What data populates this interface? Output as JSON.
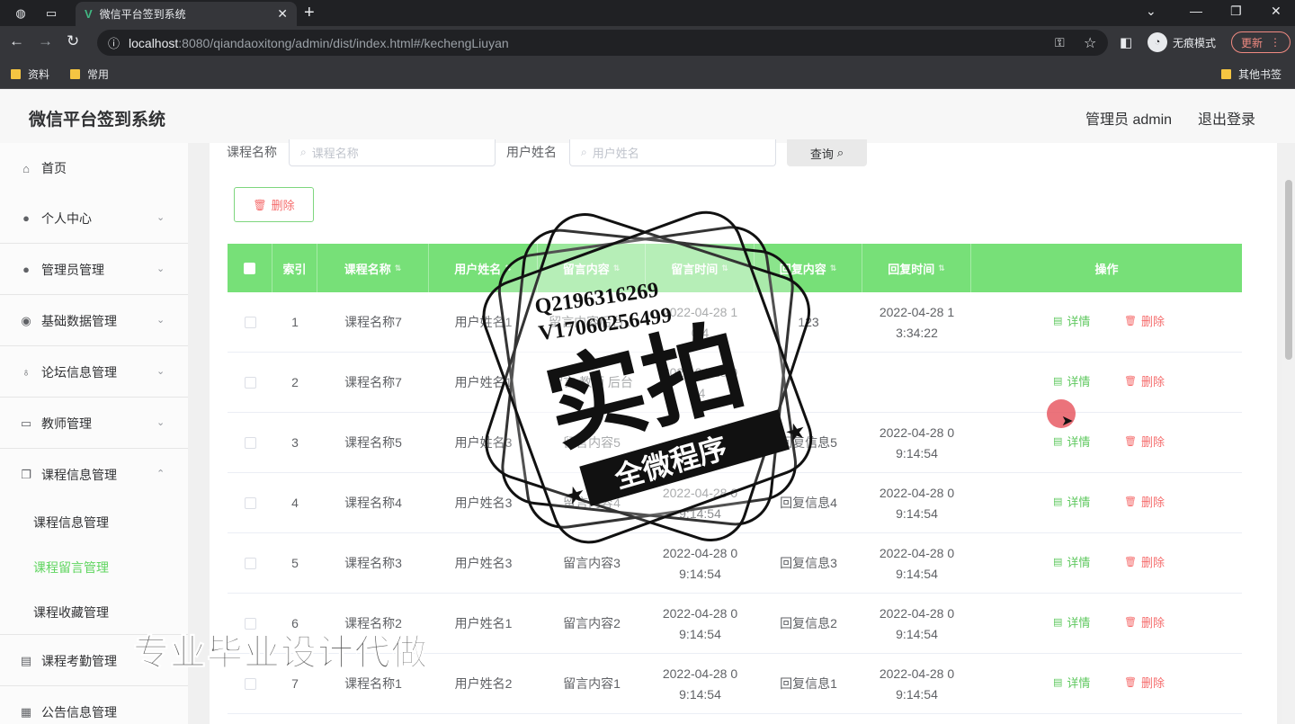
{
  "browser": {
    "tab_title": "微信平台签到系统",
    "url_host": "localhost",
    "url_rest": ":8080/qiandaoxitong/admin/dist/index.html#/kechengLiuyan",
    "incognito_label": "无痕模式",
    "update_label": "更新",
    "bookmarks": [
      "资料",
      "常用"
    ],
    "other_bookmarks": "其他书签"
  },
  "header": {
    "title": "微信平台签到系统",
    "admin": "管理员 admin",
    "logout": "退出登录"
  },
  "sidebar": {
    "items": [
      {
        "label": "首页",
        "icon": "home-icon"
      },
      {
        "label": "个人中心",
        "icon": "user-icon"
      },
      {
        "label": "管理员管理",
        "icon": "user-icon"
      },
      {
        "label": "基础数据管理",
        "icon": "location-icon"
      },
      {
        "label": "论坛信息管理",
        "icon": "microphone-icon"
      },
      {
        "label": "教师管理",
        "icon": "chat-icon"
      },
      {
        "label": "课程信息管理",
        "icon": "copy-icon"
      }
    ],
    "subitems": [
      {
        "label": "课程信息管理"
      },
      {
        "label": "课程留言管理"
      },
      {
        "label": "课程收藏管理"
      }
    ],
    "items_after": [
      {
        "label": "课程考勤管理",
        "icon": "clipboard-icon"
      },
      {
        "label": "公告信息管理",
        "icon": "grid-icon"
      }
    ]
  },
  "search": {
    "course_label": "课程名称",
    "course_placeholder": "课程名称",
    "user_label": "用户姓名",
    "user_placeholder": "用户姓名",
    "query_label": "查询"
  },
  "toolbar": {
    "delete_label": "删除"
  },
  "table": {
    "columns": [
      "索引",
      "课程名称",
      "用户姓名",
      "留言内容",
      "留言时间",
      "回复内容",
      "回复时间",
      "操作"
    ],
    "detail_label": "详情",
    "delete_label": "删除",
    "rows": [
      {
        "index": "1",
        "course": "课程名称7",
        "user": "用户姓名1",
        "message": "留言内容后台...",
        "msg_time": "2022-04-28 1 0:4",
        "reply": "123",
        "reply_time": "2022-04-28 1 3:34:22"
      },
      {
        "index": "2",
        "course": "课程名称7",
        "user": "用户姓名1",
        "message": "留言 教师 后台",
        "msg_time": "2022-04-28 0 :4",
        "reply": "",
        "reply_time": ""
      },
      {
        "index": "3",
        "course": "课程名称5",
        "user": "用户姓名3",
        "message": "留言内容5",
        "msg_time": "2022",
        "reply": "回复信息5",
        "reply_time": "2022-04-28 0 9:14:54"
      },
      {
        "index": "4",
        "course": "课程名称4",
        "user": "用户姓名3",
        "message": "留言内容4",
        "msg_time": "2022-04-28 0 9:14:54",
        "reply": "回复信息4",
        "reply_time": "2022-04-28 0 9:14:54"
      },
      {
        "index": "5",
        "course": "课程名称3",
        "user": "用户姓名3",
        "message": "留言内容3",
        "msg_time": "2022-04-28 0 9:14:54",
        "reply": "回复信息3",
        "reply_time": "2022-04-28 0 9:14:54"
      },
      {
        "index": "6",
        "course": "课程名称2",
        "user": "用户姓名1",
        "message": "留言内容2",
        "msg_time": "2022-04-28 0 9:14:54",
        "reply": "回复信息2",
        "reply_time": "2022-04-28 0 9:14:54"
      },
      {
        "index": "7",
        "course": "课程名称1",
        "user": "用户姓名2",
        "message": "留言内容1",
        "msg_time": "2022-04-28 0 9:14:54",
        "reply": "回复信息1",
        "reply_time": "2022-04-28 0 9:14:54"
      }
    ]
  },
  "watermark": {
    "line1": "Q2196316269",
    "line2": "V17060256499",
    "big": "实拍",
    "banner": "全微程序",
    "bottom": "专业毕业设计代做"
  },
  "colors": {
    "accent": "#77e078",
    "danger": "#f56c6c",
    "active_menu": "#5fd55f"
  }
}
